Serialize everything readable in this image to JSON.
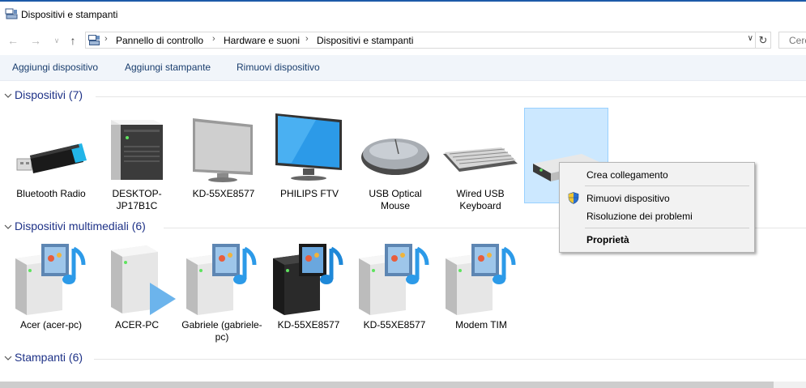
{
  "window": {
    "title": "Dispositivi e stampanti"
  },
  "address": {
    "crumbs": [
      "Pannello di controllo",
      "Hardware e suoni",
      "Dispositivi e stampanti"
    ],
    "search_placeholder": "Cerc"
  },
  "commands": [
    "Aggiungi dispositivo",
    "Aggiungi stampante",
    "Rimuovi dispositivo"
  ],
  "groups": {
    "devices": {
      "title": "Dispositivi (7)",
      "items": [
        {
          "label": "Bluetooth Radio",
          "icon": "bluetooth-dongle-icon"
        },
        {
          "label": "DESKTOP-JP17B1C",
          "icon": "desktop-tower-icon"
        },
        {
          "label": "KD-55XE8577",
          "icon": "monitor-icon"
        },
        {
          "label": "PHILIPS FTV",
          "icon": "monitor-icon"
        },
        {
          "label": "USB Optical Mouse",
          "icon": "mouse-icon"
        },
        {
          "label": "Wired USB Keyboard",
          "icon": "keyboard-icon"
        },
        {
          "label": "",
          "icon": "storage-device-icon"
        }
      ]
    },
    "media": {
      "title": "Dispositivi multimediali (6)",
      "items": [
        {
          "label": "Acer (acer-pc)",
          "icon": "media-server-icon"
        },
        {
          "label": "ACER-PC",
          "icon": "media-player-icon"
        },
        {
          "label": "Gabriele (gabriele-pc)",
          "icon": "media-server-icon"
        },
        {
          "label": "KD-55XE8577",
          "icon": "media-server-dark-icon"
        },
        {
          "label": "KD-55XE8577",
          "icon": "media-server-icon"
        },
        {
          "label": "Modem TIM",
          "icon": "media-server-icon"
        }
      ]
    },
    "printers": {
      "title": "Stampanti (6)"
    }
  },
  "context_menu": {
    "items": [
      "Crea collegamento",
      "Rimuovi dispositivo",
      "Risoluzione dei problemi",
      "Proprietà"
    ]
  },
  "colors": {
    "accent": "#1e3287",
    "selection": "#cce8ff",
    "command_text": "#1a3e6e"
  }
}
